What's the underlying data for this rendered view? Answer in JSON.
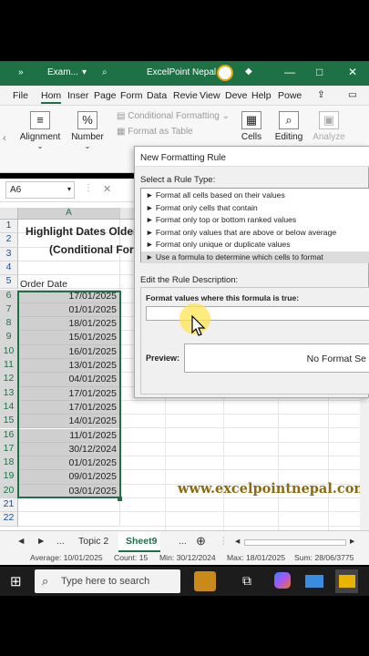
{
  "titlebar": {
    "chevron": "»",
    "file_name": "Exam...",
    "app_title": "ExcelPoint Nepal",
    "minimize": "—",
    "restore": "□",
    "close": "✕",
    "color": "#1e7145"
  },
  "ribbon_tabs": [
    "File",
    "Hom",
    "Inser",
    "Page",
    "Form",
    "Data",
    "Revie",
    "View",
    "Deve",
    "Help",
    "Powe"
  ],
  "ribbon": {
    "alignment": "Alignment",
    "number": "Number",
    "conditional_formatting": "Conditional Formatting",
    "format_as_table": "Format as Table",
    "cells": "Cells",
    "editing": "Editing",
    "analyze": "Analyze",
    "percent": "%"
  },
  "namebox": {
    "value": "A6"
  },
  "formula_bar": {
    "cancel": "✕"
  },
  "grid": {
    "column_header": "A",
    "title_line1": "Highlight Dates Older",
    "title_line2": "(Conditional For",
    "header_cell": "Order Date",
    "rows": [
      "1",
      "2",
      "3",
      "4",
      "5",
      "6",
      "7",
      "8",
      "9",
      "10",
      "11",
      "12",
      "13",
      "14",
      "15",
      "16",
      "17",
      "18",
      "19",
      "20",
      "21",
      "22"
    ],
    "dates": [
      "17/01/2025",
      "01/01/2025",
      "18/01/2025",
      "15/01/2025",
      "16/01/2025",
      "13/01/2025",
      "04/01/2025",
      "17/01/2025",
      "17/01/2025",
      "14/01/2025",
      "11/01/2025",
      "30/12/2024",
      "01/01/2025",
      "09/01/2025",
      "03/01/2025"
    ]
  },
  "watermark": "www.excelpointnepal.com",
  "dialog": {
    "title": "New Formatting Rule",
    "select_label": "Select a Rule Type:",
    "rules": [
      "► Format all cells based on their values",
      "► Format only cells that contain",
      "► Format only top or bottom ranked values",
      "► Format only values that are above or below average",
      "► Format only unique or duplicate values",
      "► Use a formula to determine which cells to format"
    ],
    "selected_rule_index": 5,
    "edit_label": "Edit the Rule Description:",
    "formula_label": "Format values where this formula is true:",
    "formula_value": "",
    "preview_label": "Preview:",
    "preview_text": "No Format Se"
  },
  "sheets": {
    "prev": "◄",
    "next": "►",
    "more_left": "...",
    "topic2": "Topic 2",
    "active": "Sheet9",
    "more_right": "...",
    "add": "⊕"
  },
  "status": {
    "average": "Average: 10/01/2025",
    "count": "Count: 15",
    "min": "Min: 30/12/2024",
    "max": "Max: 18/01/2025",
    "sum": "Sum: 28/06/3775"
  },
  "taskbar": {
    "search_placeholder": "Type here to search"
  }
}
